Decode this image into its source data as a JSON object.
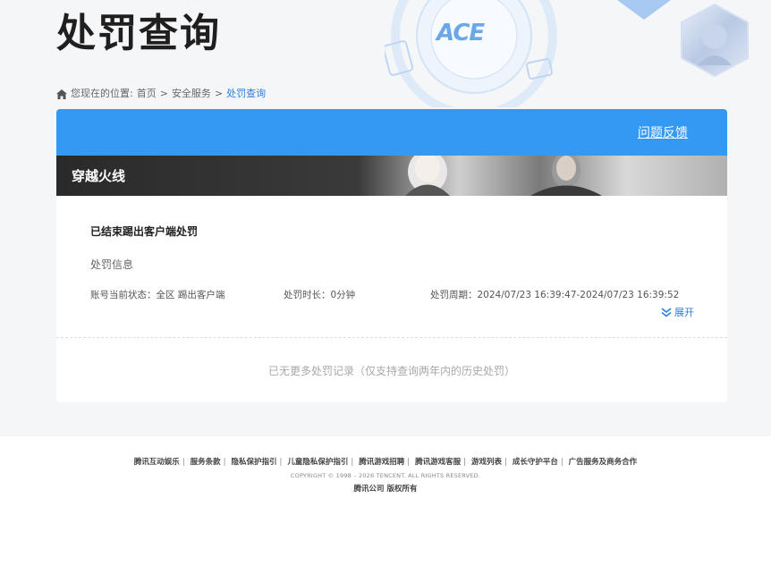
{
  "header": {
    "title": "处罚查询",
    "logo_text": "ACE"
  },
  "breadcrumb": {
    "prefix": "您现在的位置:",
    "items": [
      "首页",
      "安全服务"
    ],
    "separator": ">",
    "current": "处罚查询"
  },
  "card": {
    "feedback_label": "问题反馈",
    "game_name": "穿越火线",
    "record": {
      "title": "已结束踢出客户端处罚",
      "info_label": "处罚信息",
      "status": "账号当前状态：全区 踢出客户端",
      "duration": "处罚时长：0分钟",
      "period": "处罚周期：2024/07/23 16:39:47-2024/07/23 16:39:52",
      "expand_label": "展开"
    },
    "no_more_text": "已无更多处罚记录（仅支持查询两年内的历史处罚）"
  },
  "footer": {
    "links": [
      "腾讯互动娱乐",
      "服务条款",
      "隐私保护指引",
      "儿童隐私保护指引",
      "腾讯游戏招聘",
      "腾讯游戏客服",
      "游戏列表",
      "成长守护平台",
      "广告服务及商务合作"
    ],
    "copyright": "COPYRIGHT © 1998 – 2026 TENCENT. ALL RIGHTS RESERVED.",
    "company": "腾讯公司 版权所有"
  },
  "colors": {
    "accent": "#3399f3",
    "link": "#2b7fd8",
    "background": "#f5f6f8"
  },
  "icons": {
    "breadcrumb": "home-icon",
    "expand": "double-chevron-down-icon"
  }
}
